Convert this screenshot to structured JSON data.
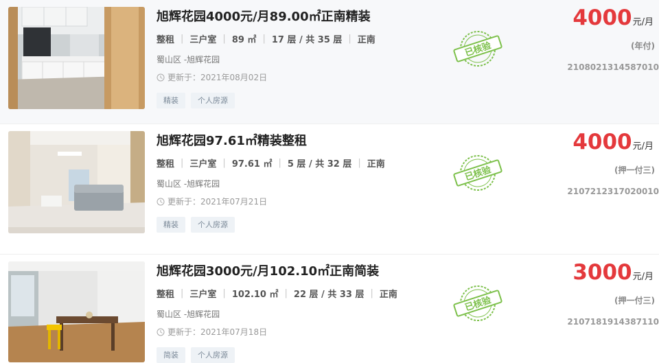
{
  "listings": [
    {
      "title": "旭辉花园4000元/月89.00㎡正南精装",
      "rent_type": "整租",
      "rooms": "三户室",
      "area": "89 ㎡",
      "floor": "17 层 / 共 35 层",
      "orientation": "正南",
      "location": "蜀山区 -旭辉花园",
      "updated": "更新于：2021年08月02日",
      "tags": [
        "精装",
        "个人房源"
      ],
      "stamp": "已核验",
      "price": "4000",
      "price_unit": "元/月",
      "payment": "(年付)",
      "code": "2108021314587010"
    },
    {
      "title": "旭辉花园97.61㎡精装整租",
      "rent_type": "整租",
      "rooms": "三户室",
      "area": "97.61 ㎡",
      "floor": "5 层 / 共 32 层",
      "orientation": "正南",
      "location": "蜀山区 -旭辉花园",
      "updated": "更新于：2021年07月21日",
      "tags": [
        "精装",
        "个人房源"
      ],
      "stamp": "已核验",
      "price": "4000",
      "price_unit": "元/月",
      "payment": "(押一付三)",
      "code": "2107212317020010"
    },
    {
      "title": "旭辉花园3000元/月102.10㎡正南简装",
      "rent_type": "整租",
      "rooms": "三户室",
      "area": "102.10 ㎡",
      "floor": "22 层 / 共 33 层",
      "orientation": "正南",
      "location": "蜀山区 -旭辉花园",
      "updated": "更新于：2021年07月18日",
      "tags": [
        "简装",
        "个人房源"
      ],
      "stamp": "已核验",
      "price": "3000",
      "price_unit": "元/月",
      "payment": "(押一付三)",
      "code": "2107181914387110"
    }
  ],
  "colors": {
    "price": "#e4393c",
    "stamp": "#7cc04a",
    "tag_bg": "#eef2f6"
  }
}
